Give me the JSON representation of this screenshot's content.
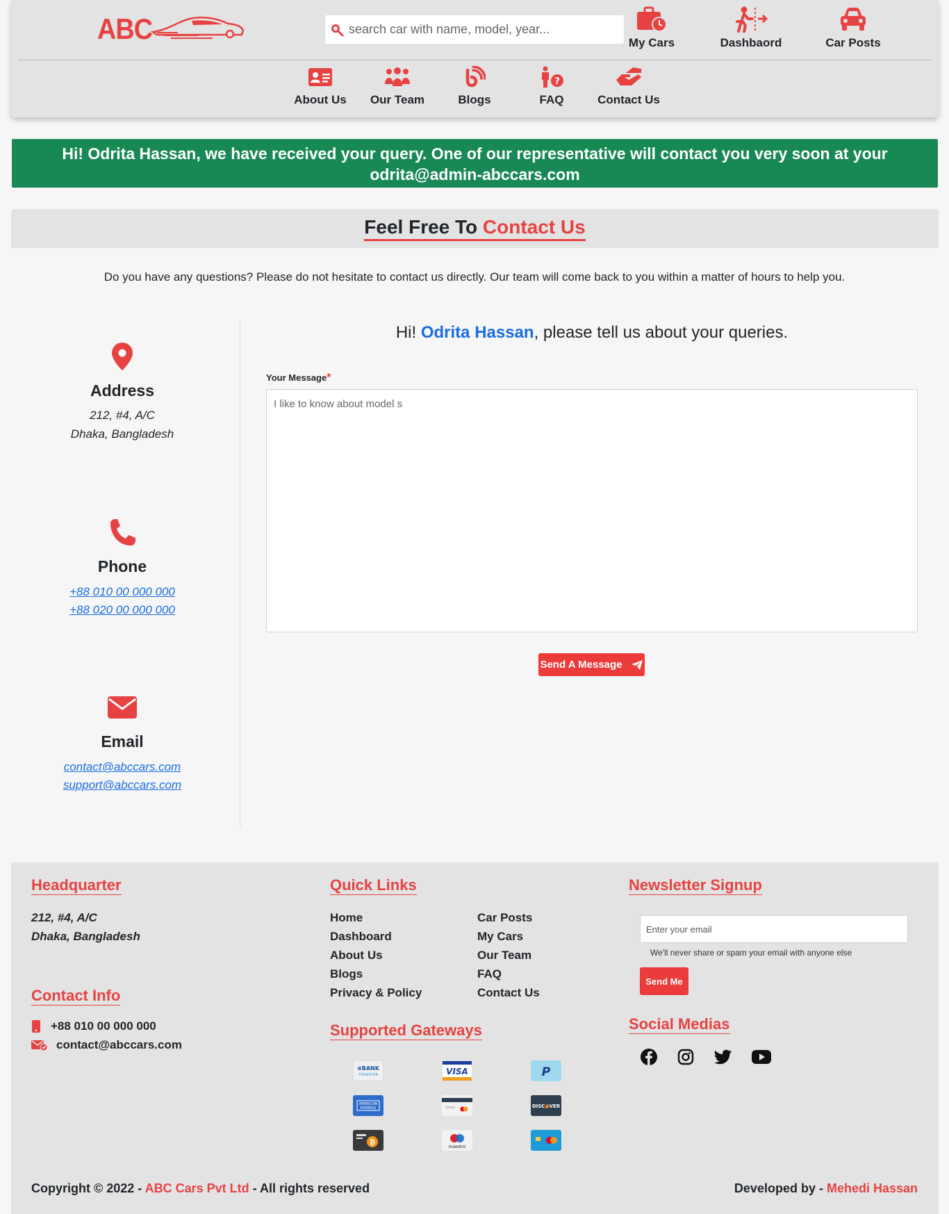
{
  "brand": {
    "name": "ABC",
    "accent": "#e74242"
  },
  "search": {
    "placeholder": "search car with name, model, year..."
  },
  "topnav": [
    {
      "label": "My Cars",
      "icon": "briefcase-clock-icon"
    },
    {
      "label": "Dashbaord",
      "icon": "person-exit-icon"
    },
    {
      "label": "Car Posts",
      "icon": "car-icon"
    }
  ],
  "subnav": [
    {
      "label": "About Us",
      "icon": "id-card-icon"
    },
    {
      "label": "Our Team",
      "icon": "users-icon"
    },
    {
      "label": "Blogs",
      "icon": "blog-icon"
    },
    {
      "label": "FAQ",
      "icon": "person-question-icon"
    },
    {
      "label": "Contact Us",
      "icon": "handshake-icon"
    }
  ],
  "alert": {
    "text": "Hi! Odrita Hassan, we have received your query. One of our representative will contact you very soon at your odrita@admin-abccars.com",
    "color": "#188955"
  },
  "page": {
    "title_prefix": "Feel Free To",
    "title_highlight": "Contact Us",
    "intro": "Do you have any questions? Please do not hesitate to contact us directly. Our team will come back to you within a matter of hours to help you."
  },
  "info": {
    "address": {
      "title": "Address",
      "line1": "212, #4, A/C",
      "line2": "Dhaka, Bangladesh"
    },
    "phone": {
      "title": "Phone",
      "line1": "+88 010 00 000 000",
      "line2": "+88 020 00 000 000"
    },
    "email": {
      "title": "Email",
      "line1": "contact@abccars.com",
      "line2": "support@abccars.com"
    }
  },
  "form": {
    "greet_prefix": "Hi! ",
    "user_name": "Odrita Hassan",
    "greet_suffix": ", please tell us about your queries.",
    "message_label": "Your Message",
    "required_mark": "*",
    "message_value": "I like to know about model s",
    "send_label": "Send A Message"
  },
  "footer": {
    "hq_title": "Headquarter",
    "hq_line1": "212, #4, A/C",
    "hq_line2": "Dhaka, Bangladesh",
    "contact_title": "Contact Info",
    "contact_phone": "+88 010 00 000 000",
    "contact_email": "contact@abccars.com",
    "links_title": "Quick Links",
    "links": [
      "Home",
      "Car Posts",
      "Dashboard",
      "My Cars",
      "About Us",
      "Our Team",
      "Blogs",
      "FAQ",
      "Privacy & Policy",
      "Contact Us"
    ],
    "gateways_title": "Supported Gateways",
    "gateways": [
      "BANK TRANSFER",
      "VISA",
      "PayPal",
      "AMERICAN EXPRESS",
      "card",
      "DISCOVER",
      "bitcoin",
      "maestro",
      "mastercard"
    ],
    "newsletter_title": "Newsletter Signup",
    "newsletter_placeholder": "Enter your email",
    "newsletter_note": "We'll never share or spam your email with anyone else",
    "newsletter_button": "Send Me",
    "social_title": "Social Medias",
    "copyright_prefix": "Copyright © 2022 - ",
    "company": "ABC Cars Pvt Ltd",
    "copyright_suffix": " - All rights reserved",
    "dev_prefix": "Developed by - ",
    "developer": "Mehedi Hassan"
  }
}
